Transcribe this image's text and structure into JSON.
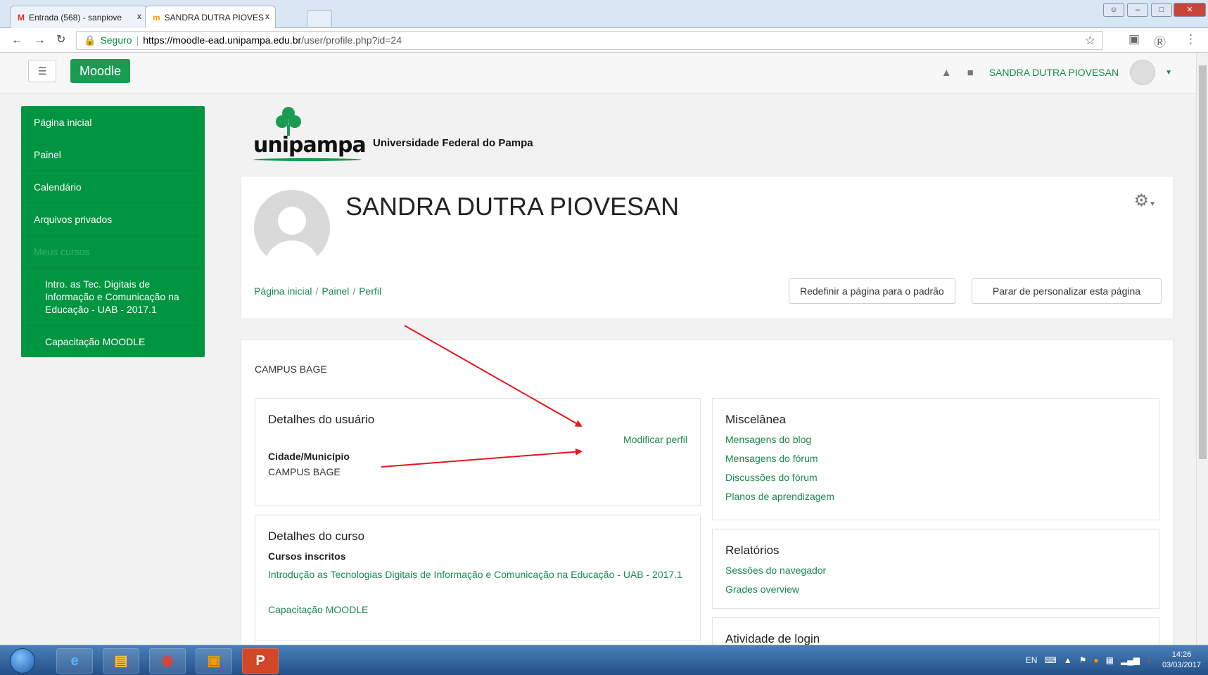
{
  "browser": {
    "tabs": [
      {
        "icon": "M",
        "title": "Entrada (568) - sanpiove",
        "close": "x"
      },
      {
        "icon": "m",
        "title": "SANDRA DUTRA PIOVES",
        "close": "x"
      }
    ],
    "window_title": "",
    "secure_label": "Seguro",
    "url_scheme_host": "https://moodle-ead.unipampa.edu.br",
    "url_path": "/user/profile.php?id=24"
  },
  "moodle": {
    "brand": "Moodle",
    "user_name": "SANDRA DUTRA PIOVESAN"
  },
  "sidebar": {
    "items": [
      {
        "label": "Página inicial"
      },
      {
        "label": "Painel"
      },
      {
        "label": "Calendário"
      },
      {
        "label": "Arquivos privados"
      },
      {
        "label": "Meus cursos"
      },
      {
        "label": "Intro. as Tec. Digitais de Informação e Comunicação na Educação - UAB - 2017.1"
      },
      {
        "label": "Capacitação MOODLE"
      }
    ]
  },
  "logo": {
    "wordmark": "unipampa",
    "university_name": "Universidade Federal do Pampa"
  },
  "profile": {
    "fullname": "SANDRA DUTRA PIOVESAN",
    "breadcrumb": [
      "Página inicial",
      "Painel",
      "Perfil"
    ],
    "reset_button": "Redefinir a página para o padrão",
    "stop_button": "Parar de personalizar esta página",
    "campus_description": "CAMPUS BAGE"
  },
  "user_details": {
    "title": "Detalhes do usuário",
    "edit_link": "Modificar perfil",
    "city_label": "Cidade/Município",
    "city_value": "CAMPUS BAGE"
  },
  "course_details": {
    "title": "Detalhes do curso",
    "enrolled_label": "Cursos inscritos",
    "courses": [
      "Introdução as Tecnologias Digitais de Informação e Comunicação na Educação - UAB - 2017.1",
      "Capacitação MOODLE"
    ]
  },
  "misc": {
    "title": "Miscelânea",
    "links": [
      "Mensagens do blog",
      "Mensagens do fórum",
      "Discussões do fórum",
      "Planos de aprendizagem"
    ]
  },
  "reports": {
    "title": "Relatórios",
    "links": [
      "Sessões do navegador",
      "Grades overview"
    ]
  },
  "login_activity": {
    "title": "Atividade de login"
  },
  "taskbar": {
    "lang": "EN",
    "time": "14:26",
    "date": "03/03/2017"
  },
  "colors": {
    "moodle_green": "#009540",
    "link_green": "#1b8a4a",
    "annotation_arrow": "#e8161c"
  },
  "icons": [
    "menu-icon",
    "bell-icon",
    "chat-icon",
    "gear-icon",
    "lock-icon",
    "star-icon",
    "windows-start-icon",
    "ie-icon",
    "folder-icon",
    "chrome-icon",
    "outlook-icon",
    "powerpoint-icon"
  ]
}
